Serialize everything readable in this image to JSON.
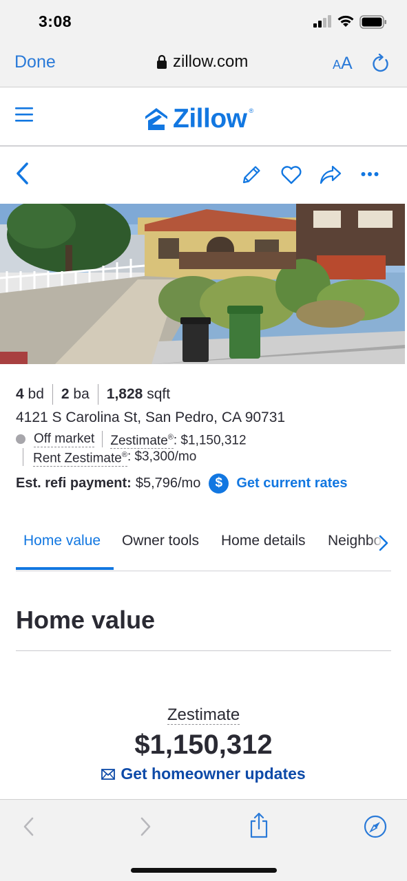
{
  "status_bar": {
    "time": "3:08"
  },
  "safari": {
    "done_label": "Done",
    "url": "zillow.com",
    "text_size_small": "A",
    "text_size_big": "A"
  },
  "zillow": {
    "logo_text": "Zillow",
    "logo_reg": "®",
    "brand_color": "#1277e1"
  },
  "listing": {
    "beds_value": "4",
    "beds_unit": "bd",
    "baths_value": "2",
    "baths_unit": "ba",
    "sqft_value": "1,828",
    "sqft_unit": "sqft",
    "address": "4121 S Carolina St, San Pedro, CA 90731",
    "status": "Off market",
    "zestimate_label": "Zestimate",
    "zestimate_value": ": $1,150,312",
    "rent_label": "Rent Zestimate",
    "rent_value": ": $3,300/mo",
    "refi_label": "Est. refi payment:",
    "refi_value": "$5,796/mo",
    "dollar_symbol": "$",
    "rates_link": "Get current rates"
  },
  "tabs": [
    {
      "label": "Home value",
      "active": true
    },
    {
      "label": "Owner tools",
      "active": false
    },
    {
      "label": "Home details",
      "active": false
    },
    {
      "label": "Neighborhood",
      "active": false
    }
  ],
  "home_value": {
    "title": "Home value",
    "zestimate_label": "Zestimate",
    "zestimate_amount": "$1,150,312",
    "updates_link": "Get homeowner updates"
  },
  "icons": {
    "menu": "hamburger-icon",
    "back": "chevron-left-icon",
    "edit": "pencil-icon",
    "save": "heart-icon",
    "share": "share-icon",
    "more": "more-icon",
    "scroll_tabs": "chevron-right-icon",
    "email": "mail-icon",
    "safari_share": "share-sheet-icon",
    "safari_browser": "compass-icon"
  }
}
